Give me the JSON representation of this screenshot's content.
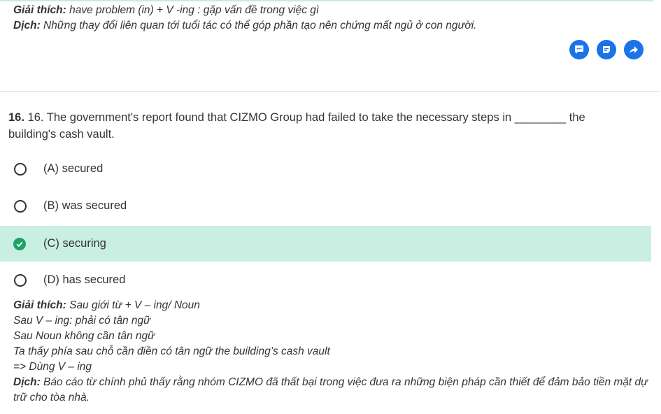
{
  "previous": {
    "explain_label": "Giải thích:",
    "explain_text": " have problem (in) + V -ing : gặp vấn đề trong việc gì",
    "translate_label": "Dịch:",
    "translate_text": " Những thay đổi liên quan tới tuổi tác có thể góp phần tạo nên chứng mất ngủ ở con người."
  },
  "actions": {
    "icons": [
      "comment-icon",
      "note-icon",
      "share-icon"
    ],
    "color": "#1a73e8"
  },
  "question": {
    "number": "16.",
    "text": " 16. The government's report found that CIZMO Group had failed to take the necessary steps in ________ the building's cash vault."
  },
  "options": [
    {
      "label": "(A) secured",
      "selected": false
    },
    {
      "label": "(B) was secured",
      "selected": false
    },
    {
      "label": "(C) securing",
      "selected": true
    },
    {
      "label": "(D) has secured",
      "selected": false
    }
  ],
  "explanation": {
    "explain_label": "Giải thích:",
    "explain_text": " Sau giới từ + V – ing/ Noun",
    "lines": [
      "Sau V – ing: phải có tân ngữ",
      "Sau Noun không cần tân ngữ",
      "Ta thấy phía sau chỗ cần điền có tân ngữ the building’s cash vault",
      "=> Dùng V – ing"
    ],
    "translate_label": "Dịch:",
    "translate_text": " Báo cáo từ chính phủ thấy rằng nhóm CIZMO đã thất bại trong việc đưa ra những biện pháp cần thiết để đảm bảo tiền mặt dự trữ cho tòa nhà."
  },
  "colors": {
    "selected_bg": "#c9eee2",
    "correct_check": "#1ea365",
    "top_rule": "#c8eadb"
  }
}
